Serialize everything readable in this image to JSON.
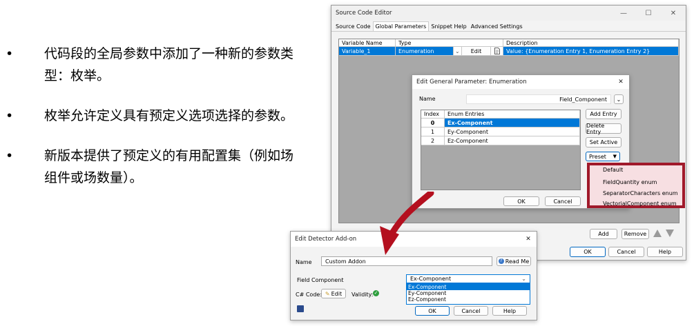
{
  "bullets": [
    {
      "marker": "•",
      "text": "代码段的全局参数中添加了一种新的参数类型：枚举。"
    },
    {
      "marker": "•",
      "text": "枚举允许定义具有预定义选项选择的参数。"
    },
    {
      "marker": "•",
      "text": "新版本提供了预定义的有用配置集（例如场组件或场数量）。"
    }
  ],
  "source_editor": {
    "title": "Source Code Editor",
    "controls": {
      "minimize": "—",
      "maximize": "☐",
      "close": "✕"
    },
    "tabs": [
      "Source Code",
      "Global Parameters",
      "Snippet Help",
      "Advanced Settings"
    ],
    "columns": [
      "Variable Name",
      "Type",
      "Description"
    ],
    "row": {
      "name": "Variable_1",
      "type": "Enumeration",
      "edit": "Edit",
      "description": "Value: {Enumeration Entry 1, Enumeration Entry 2}"
    },
    "buttons": {
      "add": "Add",
      "remove": "Remove",
      "ok": "OK",
      "cancel": "Cancel",
      "help": "Help"
    }
  },
  "edit_param": {
    "title": "Edit General Parameter: Enumeration",
    "close": "✕",
    "name_label": "Name",
    "name_value": "Field_Component",
    "columns": [
      "Index",
      "Enum Entries"
    ],
    "rows": [
      {
        "index": "0",
        "entry": "Ex-Component"
      },
      {
        "index": "1",
        "entry": "Ey-Component"
      },
      {
        "index": "2",
        "entry": "Ez-Component"
      }
    ],
    "buttons": {
      "add_entry": "Add Entry",
      "delete_entry": "Delete Entry",
      "set_active": "Set Active",
      "preset": "Preset",
      "ok": "OK",
      "cancel": "Cancel"
    }
  },
  "preset_menu": [
    "Default",
    "FieldQuantity enum",
    "SeparatorCharacters enum",
    "VectorialComponent enum"
  ],
  "detector": {
    "title": "Edit Detector Add-on",
    "close": "✕",
    "name_label": "Name",
    "name_value": "Custom  Addon",
    "read_me": "Read Me",
    "field_label": "Field Component",
    "field_value": "Ex-Component",
    "options": [
      "Ex-Component",
      "Ey-Component",
      "Ez-Component"
    ],
    "code_label": "C# Code:",
    "edit": "Edit",
    "validity": "Validity:",
    "ok": "OK",
    "cancel": "Cancel",
    "help": "Help"
  },
  "colors": {
    "accent": "#0078d7",
    "highlight_border": "#a0192a",
    "arrow": "#b4101f"
  }
}
